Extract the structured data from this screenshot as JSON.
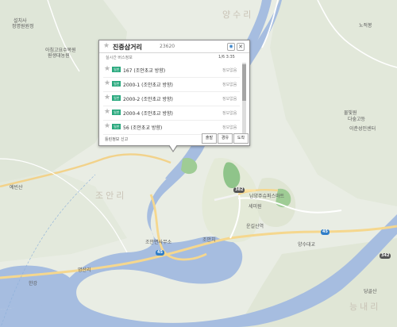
{
  "map_labels": {
    "top_left_1": "설치사",
    "top_left_2": "정명원원정",
    "arboretum_1": "아침고요수목원",
    "arboretum_2": "원생대농원",
    "peak": "예빈산",
    "top_right": "노적봉",
    "camp": "물빛원",
    "restaurant": "다숲고등",
    "farm": "이춘성인센터",
    "jo_an_ri_label": "조안리",
    "hamlet": "조안치",
    "station": "조안면사무소",
    "riverside_center": "남양주슈퍼스마트",
    "island": "세미원",
    "yangsu_label": "양수리",
    "station2": "운길산역",
    "river_left": "한강",
    "myeong": "명산리",
    "dang": "당골산",
    "bottom_place": "능내리",
    "road_badge_1": "45",
    "road_badge_2": "382",
    "road_badge_3": "45",
    "road_badge_4": "342",
    "bridge": "양수대교"
  },
  "popup": {
    "title": "진중삼거리",
    "code": "23620",
    "subtitle": "실시간 버스정보",
    "time": "1/6 3:35",
    "rows": [
      {
        "tag": "일반",
        "route": "167 (조안초교 방향)",
        "status": "정보없음"
      },
      {
        "tag": "일반",
        "route": "2000-1 (조안초교 방향)",
        "status": "정보없음"
      },
      {
        "tag": "일반",
        "route": "2000-2 (조안초교 방향)",
        "status": "정보없음"
      },
      {
        "tag": "일반",
        "route": "2000-4 (조안초교 방향)",
        "status": "정보없음"
      },
      {
        "tag": "일반",
        "route": "56 (조안초교 방향)",
        "status": "정보없음"
      }
    ],
    "report_label": "틀린정보 신고",
    "buttons": [
      "출발",
      "경유",
      "도착"
    ]
  }
}
